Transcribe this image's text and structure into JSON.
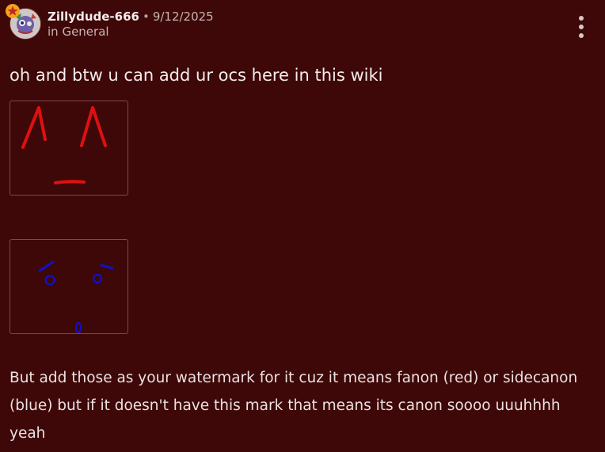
{
  "post": {
    "username": "Zillydude-666",
    "separator": "•",
    "date": "9/12/2025",
    "location": "in General",
    "title": "oh and btw u can add ur ocs here in this wiki",
    "body": "But add those as your watermark for it cuz it means fanon (red) or sidecanon (blue) but if it doesn't have this mark that means its canon soooo uuuhhhh yeah"
  },
  "icons": {
    "avatar": "user-avatar",
    "badge": "star-badge-icon",
    "menu": "more-vertical-icon"
  },
  "colors": {
    "background": "#3e0808",
    "fanon_mark": "#e01010",
    "sidecanon_mark": "#1010d0"
  }
}
